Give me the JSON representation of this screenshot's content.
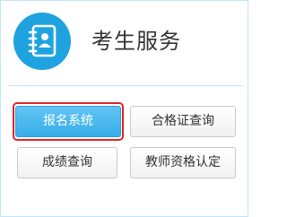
{
  "header": {
    "title": "考生服务",
    "icon": "contact-book-icon",
    "icon_color": "#1fa3e0"
  },
  "buttons": {
    "registration": "报名系统",
    "certificate_query": "合格证查询",
    "score_query": "成绩查询",
    "teacher_certification": "教师资格认定"
  },
  "colors": {
    "primary_button": "#37aee9",
    "highlight_border": "#e02424",
    "panel_border": "#bfe6f8"
  }
}
